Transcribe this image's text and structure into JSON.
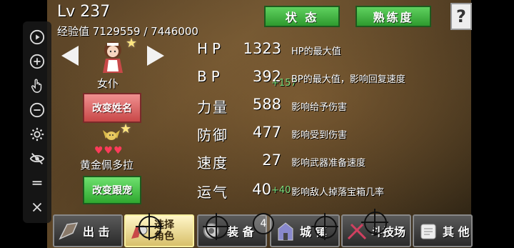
{
  "player": {
    "level": "Lv 237",
    "exp": "经验值 7129559 / 7446000"
  },
  "tabs": {
    "status": "状 态",
    "proficiency": "熟练度"
  },
  "help_label": "?",
  "character": {
    "name": "女仆",
    "rename_button": "改变姓名"
  },
  "pet": {
    "hearts": "♥♥♥",
    "name": "黄金佩多拉",
    "change_button": "改变跟宠"
  },
  "stats": [
    {
      "label": "HP",
      "value": "1323",
      "bonus": "",
      "desc": "HP的最大值"
    },
    {
      "label": "BP",
      "value": "392",
      "bonus": "+157",
      "desc": "BP的最大值，影响回复速度"
    },
    {
      "label": "力量",
      "value": "588",
      "bonus": "",
      "desc": "影响给予伤害"
    },
    {
      "label": "防御",
      "value": "477",
      "bonus": "",
      "desc": "影响受到伤害"
    },
    {
      "label": "速度",
      "value": "27",
      "bonus": "",
      "desc": "影响武器准备速度"
    },
    {
      "label": "运气",
      "value": "40",
      "bonus": "+40",
      "desc": "影响敌人掉落宝箱几率"
    }
  ],
  "nav": {
    "sortie": "出 击",
    "select_char": "选择\n角色",
    "equip": "装 备",
    "castle": "城 镇",
    "arena": "斗技场",
    "other": "其 他"
  },
  "overlay_marker": "4",
  "colors": {
    "tab_green": "#3fb83f",
    "rename_pink": "#e06a6a",
    "bonus_green": "#7ee07e",
    "heart_red": "#ff3b5a"
  }
}
